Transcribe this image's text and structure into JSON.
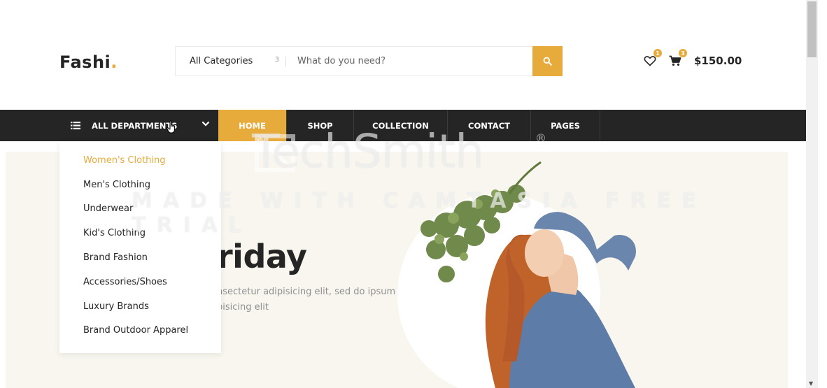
{
  "header": {
    "logo_text": "Fashi",
    "logo_dot": ".",
    "search": {
      "category_label": "All Categories",
      "category_arrow": "3",
      "placeholder": "What do you need?",
      "button_icon": "search-icon"
    },
    "wishlist": {
      "icon": "heart-icon",
      "count": "1"
    },
    "cart": {
      "icon": "cart-icon",
      "count": "3",
      "total": "$150.00"
    }
  },
  "nav": {
    "departments_label": "ALL DEPARTMENTS",
    "items": [
      {
        "label": "HOME",
        "active": true
      },
      {
        "label": "SHOP"
      },
      {
        "label": "COLLECTION"
      },
      {
        "label": "CONTACT"
      },
      {
        "label": "PAGES"
      }
    ]
  },
  "departments_menu": {
    "items": [
      {
        "label": "Women's Clothing",
        "active": true
      },
      {
        "label": "Men's Clothing"
      },
      {
        "label": "Underwear"
      },
      {
        "label": "Kid's Clothing"
      },
      {
        "label": "Brand Fashion"
      },
      {
        "label": "Accessories/Shoes"
      },
      {
        "label": "Luxury Brands"
      },
      {
        "label": "Brand Outdoor Apparel"
      }
    ]
  },
  "hero": {
    "title": "riday",
    "text_line1": "nsectetur adipisicing elit, sed do ipsum",
    "text_line2": "pisicing elit"
  },
  "watermark": {
    "brand": "TechSmith",
    "registered": "®",
    "subtitle": "MADE WITH CAMTASIA FREE TRIAL"
  },
  "colors": {
    "accent": "#e7ab3c",
    "nav_bg": "#252525",
    "hero_bg": "#f8f6ef"
  }
}
